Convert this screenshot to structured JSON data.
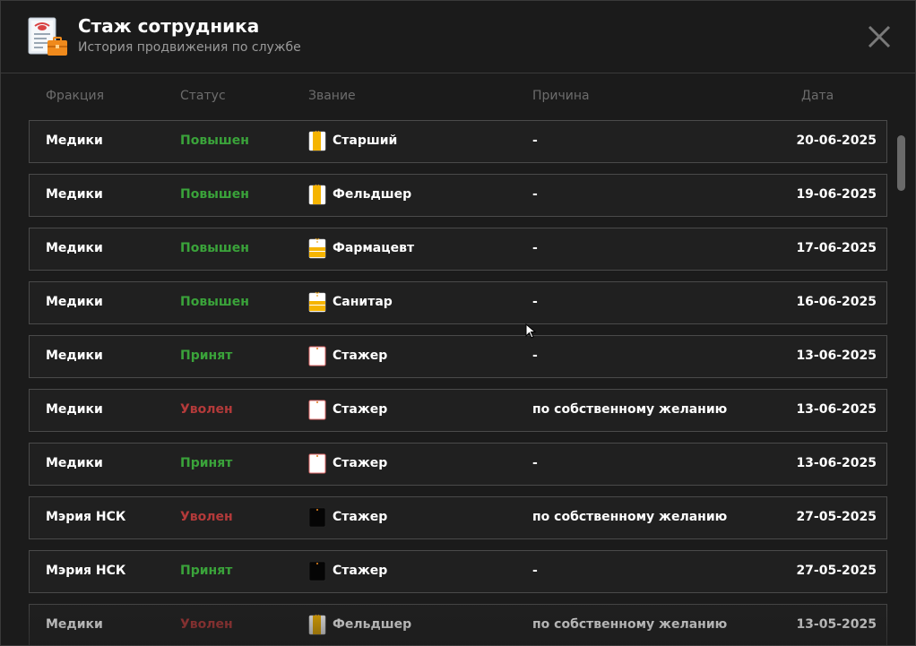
{
  "header": {
    "title": "Стаж сотрудника",
    "subtitle": "История продвижения по службе",
    "icon": "employee-record-icon",
    "close_icon": "close-icon"
  },
  "columns": {
    "faction": "Фракция",
    "status": "Статус",
    "rank": "Звание",
    "reason": "Причина",
    "date": "Дата"
  },
  "colors": {
    "status_promoted": "#3aa33a",
    "status_fired": "#b33a3a",
    "text_primary": "#ffffff",
    "text_muted": "#6c6c6c",
    "background": "#1b1b1b",
    "row_border": "#4a4a4a"
  },
  "rows": [
    {
      "faction": "Медики",
      "status": "Повышен",
      "status_type": "green",
      "rank": "Старший",
      "rank_icon": "rank-vertical-gold-stripe-icon",
      "reason": "-",
      "date": "20-06-2025"
    },
    {
      "faction": "Медики",
      "status": "Повышен",
      "status_type": "green",
      "rank": "Фельдшер",
      "rank_icon": "rank-vertical-gold-stripe-icon",
      "reason": "-",
      "date": "19-06-2025"
    },
    {
      "faction": "Медики",
      "status": "Повышен",
      "status_type": "green",
      "rank": "Фармацевт",
      "rank_icon": "rank-horizontal-gold-stripes-icon",
      "reason": "-",
      "date": "17-06-2025"
    },
    {
      "faction": "Медики",
      "status": "Повышен",
      "status_type": "green",
      "rank": "Санитар",
      "rank_icon": "rank-horizontal-gold-stripes-icon",
      "reason": "-",
      "date": "16-06-2025"
    },
    {
      "faction": "Медики",
      "status": "Принят",
      "status_type": "green",
      "rank": "Стажер",
      "rank_icon": "rank-white-plain-icon",
      "reason": "-",
      "date": "13-06-2025"
    },
    {
      "faction": "Медики",
      "status": "Уволен",
      "status_type": "red",
      "rank": "Стажер",
      "rank_icon": "rank-white-plain-icon",
      "reason": "по собственному желанию",
      "date": "13-06-2025"
    },
    {
      "faction": "Медики",
      "status": "Принят",
      "status_type": "green",
      "rank": "Стажер",
      "rank_icon": "rank-white-plain-icon",
      "reason": "-",
      "date": "13-06-2025"
    },
    {
      "faction": "Мэрия НСК",
      "status": "Уволен",
      "status_type": "red",
      "rank": "Стажер",
      "rank_icon": "rank-black-plain-icon",
      "reason": "по собственному желанию",
      "date": "27-05-2025"
    },
    {
      "faction": "Мэрия НСК",
      "status": "Принят",
      "status_type": "green",
      "rank": "Стажер",
      "rank_icon": "rank-black-plain-icon",
      "reason": "-",
      "date": "27-05-2025"
    },
    {
      "faction": "Медики",
      "status": "Уволен",
      "status_type": "red",
      "rank": "Фельдшер",
      "rank_icon": "rank-vertical-gold-stripe-icon",
      "reason": "по собственному желанию",
      "date": "13-05-2025"
    }
  ]
}
